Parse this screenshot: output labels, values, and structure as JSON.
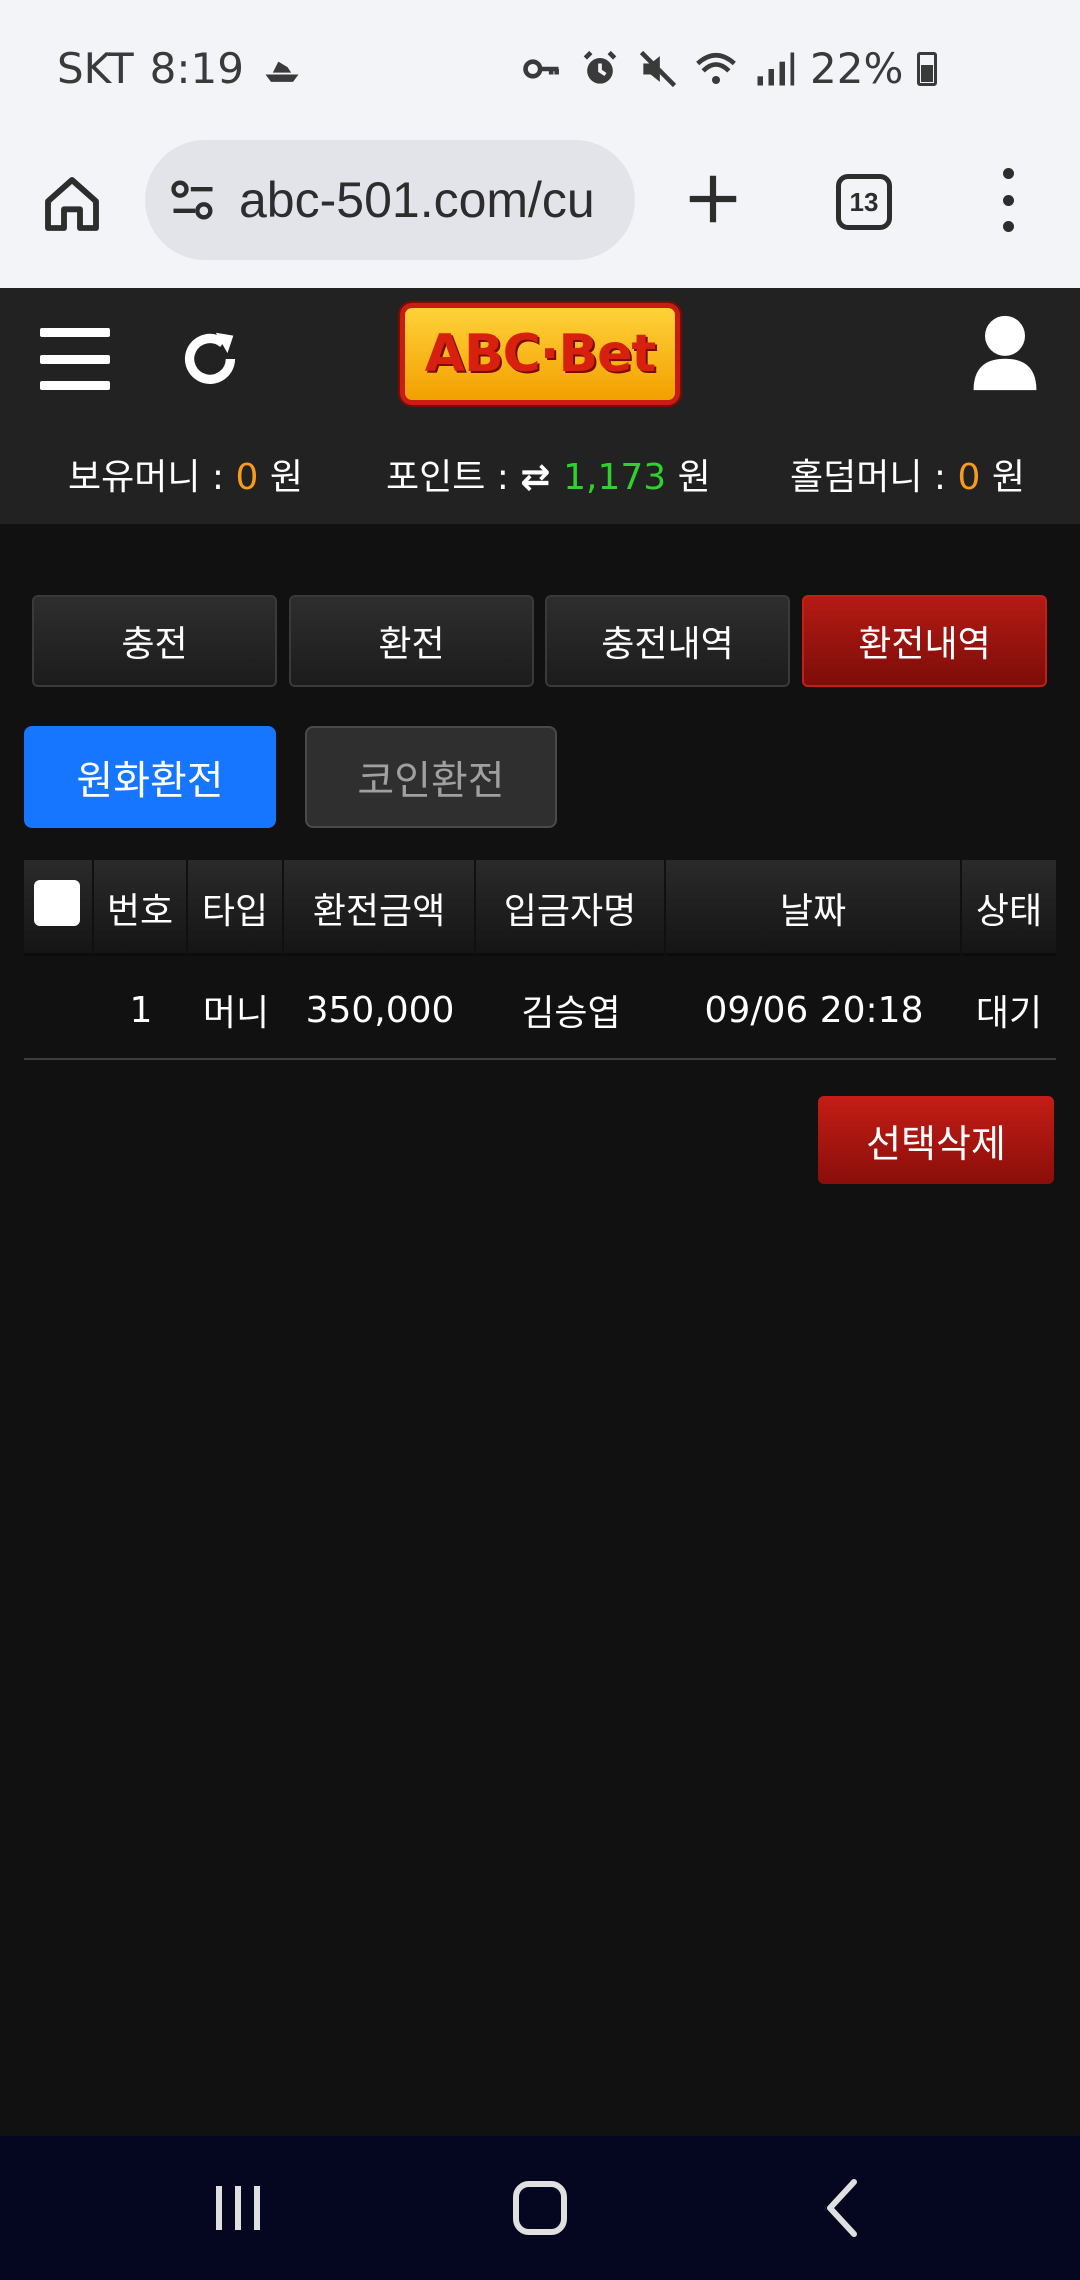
{
  "status_bar": {
    "carrier": "SKT",
    "time": "8:19",
    "battery": "22%",
    "icons": [
      "boat-icon",
      "key-icon",
      "alarm-icon",
      "mute-icon",
      "wifi-icon",
      "signal-icon",
      "battery-icon"
    ]
  },
  "browser": {
    "url": "abc-501.com/cu",
    "tab_count": "13"
  },
  "header": {
    "logo": "ABC·Bet",
    "wallet": [
      {
        "label": "보유머니 : ",
        "value": "0",
        "unit": " 원"
      },
      {
        "label": "포인트 : ",
        "value": "1,173",
        "unit": " 원"
      },
      {
        "label": "홀덤머니 : ",
        "value": "0",
        "unit": " 원"
      }
    ]
  },
  "tabs": [
    "충전",
    "환전",
    "충전내역",
    "환전내역"
  ],
  "sub_tabs": [
    "원화환전",
    "코인환전"
  ],
  "table": {
    "headers": [
      "번호",
      "타입",
      "환전금액",
      "입금자명",
      "날짜",
      "상태"
    ],
    "rows": [
      [
        "1",
        "머니",
        "350,000",
        "김승엽",
        "09/06 20:18",
        "대기"
      ]
    ]
  },
  "delete_button": "선택삭제",
  "colors": {
    "accent_red": "#b51a14",
    "accent_blue": "#1676ff",
    "orange": "#f79a1e",
    "green": "#2ed12e"
  }
}
